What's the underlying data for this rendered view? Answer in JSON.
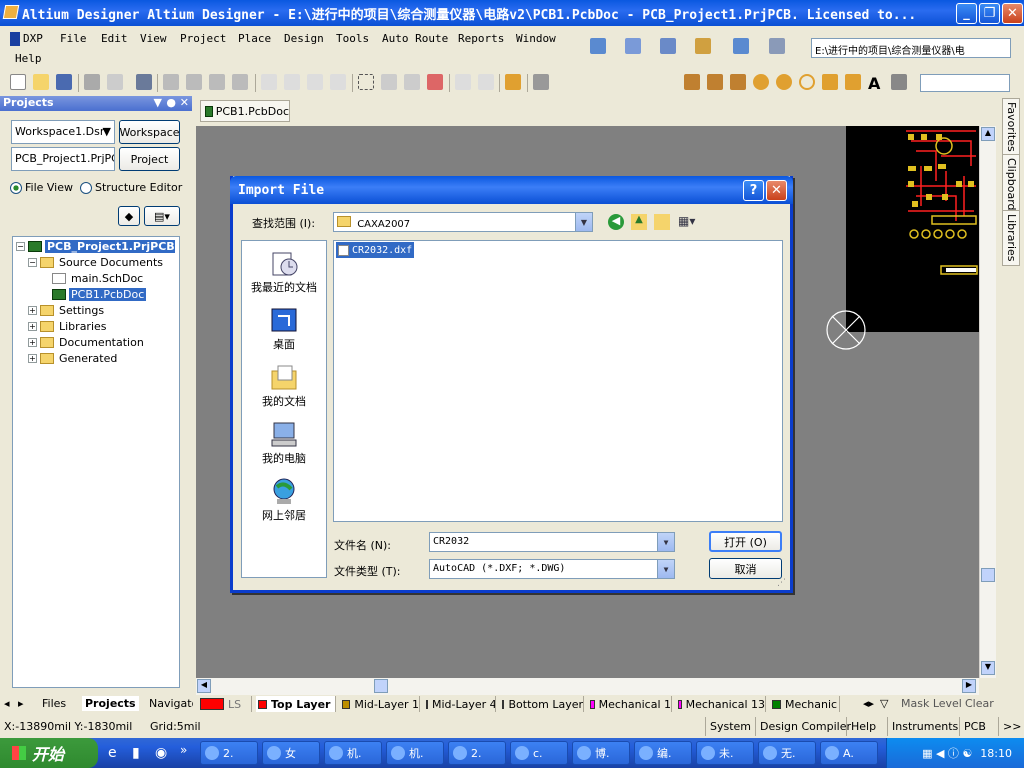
{
  "window": {
    "title": "Altium Designer Altium Designer - E:\\进行中的项目\\综合测量仪器\\电路v2\\PCB1.PcbDoc - PCB_Project1.PrjPCB. Licensed to...",
    "minimize": "_",
    "maximize": "❐",
    "close": "✕"
  },
  "menu": {
    "items": [
      "DXP",
      "File",
      "Edit",
      "View",
      "Project",
      "Place",
      "Design",
      "Tools",
      "Auto Route",
      "Reports",
      "Window",
      "Help"
    ]
  },
  "path_box": "E:\\进行中的项目\\综合测量仪器\\电",
  "projects_panel": {
    "title": "Projects",
    "workspace_combo": "Workspace1.Dsr",
    "workspace_button": "Workspace",
    "project_combo": "PCB_Project1.PrjPCB",
    "project_button": "Project",
    "view_file": "File View",
    "view_structure": "Structure Editor",
    "tree": [
      {
        "label": "PCB_Project1.PrjPCB",
        "level": 0,
        "expander": "−",
        "icon": "pcb",
        "selected": true
      },
      {
        "label": "Source Documents",
        "level": 1,
        "expander": "−",
        "icon": "folder"
      },
      {
        "label": "main.SchDoc",
        "level": 2,
        "icon": "doc"
      },
      {
        "label": "PCB1.PcbDoc",
        "level": 2,
        "icon": "pcb",
        "selected": true
      },
      {
        "label": "Settings",
        "level": 1,
        "expander": "+",
        "icon": "folder"
      },
      {
        "label": "Libraries",
        "level": 1,
        "expander": "+",
        "icon": "folder"
      },
      {
        "label": "Documentation",
        "level": 1,
        "expander": "+",
        "icon": "folder"
      },
      {
        "label": "Generated",
        "level": 1,
        "expander": "+",
        "icon": "folder"
      }
    ],
    "bottom_tabs": [
      "Files",
      "Projects",
      "Navigato"
    ]
  },
  "document_tab": "PCB1.PcbDoc",
  "side_tabs": [
    "Favorites",
    "Clipboard",
    "Libraries"
  ],
  "layers": [
    {
      "label": "LS",
      "color": "#ff0000"
    },
    {
      "label": "Top Layer",
      "color": "#ff0000",
      "active": true
    },
    {
      "label": "Mid-Layer 1",
      "color": "#bc8e00"
    },
    {
      "label": "Mid-Layer 4",
      "color": "#a080ff"
    },
    {
      "label": "Bottom Layer",
      "color": "#0000ff"
    },
    {
      "label": "Mechanical 1",
      "color": "#ff00ff"
    },
    {
      "label": "Mechanical 13",
      "color": "#ff00ff"
    },
    {
      "label": "Mechanic",
      "color": "#008000"
    }
  ],
  "layer_right": {
    "mask_level": "Mask Level",
    "clear": "Clear"
  },
  "status": {
    "coords": "X:-13890mil Y:-1830mil",
    "grid": "Grid:5mil",
    "buttons": [
      "System",
      "Design Compiler",
      "Help",
      "Instruments",
      "PCB",
      ">>"
    ]
  },
  "dialog": {
    "title": "Import File",
    "help": "?",
    "close": "✕",
    "lookin_label": "查找范围 (I):",
    "lookin_value": "CAXA2007",
    "places": [
      "我最近的文档",
      "桌面",
      "我的文档",
      "我的电脑",
      "网上邻居"
    ],
    "files": [
      "CR2032.dxf"
    ],
    "filename_label": "文件名 (N):",
    "filename_value": "CR2032",
    "filetype_label": "文件类型 (T):",
    "filetype_value": "AutoCAD (*.DXF; *.DWG)",
    "open_button": "打开 (O)",
    "cancel_button": "取消"
  },
  "taskbar": {
    "start": "开始",
    "buttons": [
      "2.",
      "女",
      "机.",
      "机.",
      "2.",
      "c.",
      "博.",
      "编.",
      "未.",
      "无.",
      "A."
    ],
    "clock": "18:10"
  }
}
